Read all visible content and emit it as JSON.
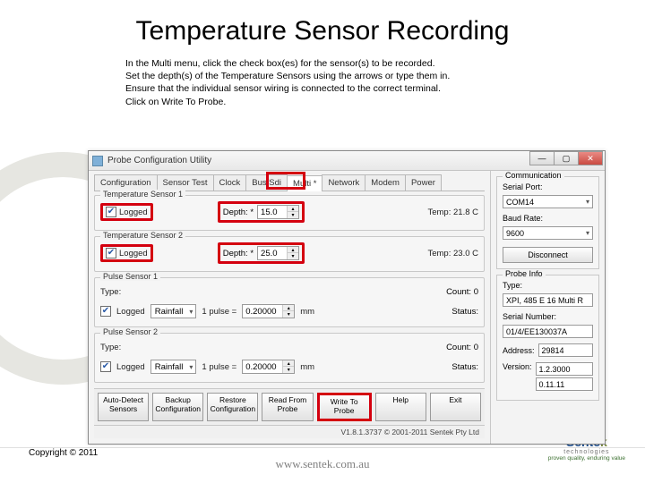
{
  "slide": {
    "title": "Temperature Sensor Recording",
    "instructions": [
      "In the Multi menu, click the check box(es) for the sensor(s) to be recorded.",
      "Set the depth(s) of the Temperature Sensors using the arrows or type them in.",
      "Ensure that the individual sensor wiring is connected to the correct terminal.",
      "Click on Write To Probe."
    ],
    "copyright": "Copyright © 2011"
  },
  "window": {
    "title": "Probe Configuration Utility",
    "tabs": [
      "Configuration",
      "Sensor Test",
      "Clock",
      "Bus/Sdi",
      "Multi *",
      "Network",
      "Modem",
      "Power"
    ],
    "active_tab": "Multi *",
    "temp_sensor_1": {
      "title": "Temperature Sensor 1",
      "logged_label": "Logged",
      "logged": true,
      "depth_label": "Depth: *",
      "depth": "15.0",
      "temp_label": "Temp:",
      "temp_value": "21.8 C"
    },
    "temp_sensor_2": {
      "title": "Temperature Sensor 2",
      "logged_label": "Logged",
      "logged": true,
      "depth_label": "Depth: *",
      "depth": "25.0",
      "temp_value": "23.0 C"
    },
    "pulse_sensor_1": {
      "title": "Pulse Sensor 1",
      "logged_label": "Logged",
      "logged": true,
      "type_label": "Type:",
      "type_value": "Rainfall",
      "pulse_label": "1 pulse =",
      "pulse_value": "0.20000",
      "unit": "mm",
      "count_label": "Count:",
      "count_value": "0",
      "status_label": "Status:"
    },
    "pulse_sensor_2": {
      "title": "Pulse Sensor 2",
      "logged_label": "Logged",
      "logged": true,
      "type_value": "Rainfall",
      "pulse_value": "0.20000",
      "unit": "mm",
      "count_value": "0"
    },
    "buttons": {
      "auto_detect": "Auto-Detect Sensors",
      "backup": "Backup Configuration",
      "restore": "Restore Configuration",
      "read": "Read From Probe",
      "write": "Write To Probe",
      "help": "Help",
      "exit": "Exit"
    },
    "status": "V1.8.1.3737 © 2001-2011 Sentek Pty Ltd",
    "comm": {
      "title": "Communication",
      "serial_port_label": "Serial Port:",
      "serial_port": "COM14",
      "baud_label": "Baud Rate:",
      "baud": "9600",
      "disconnect": "Disconnect"
    },
    "probe_info": {
      "title": "Probe Info",
      "type_label": "Type:",
      "type": "XPI, 485 E 16 Multi R",
      "serial_label": "Serial Number:",
      "serial": "01/4/EE130037A",
      "address_label": "Address:",
      "address": "29814",
      "version_label": "Version:",
      "version1": "1.2.3000",
      "version2": "0.11.11"
    }
  },
  "footer": {
    "url": "www.sentek.com.au",
    "logo_name_a": "Sente",
    "logo_name_b": "k",
    "logo_sub": "technologies",
    "logo_tag": "proven quality, enduring value"
  }
}
